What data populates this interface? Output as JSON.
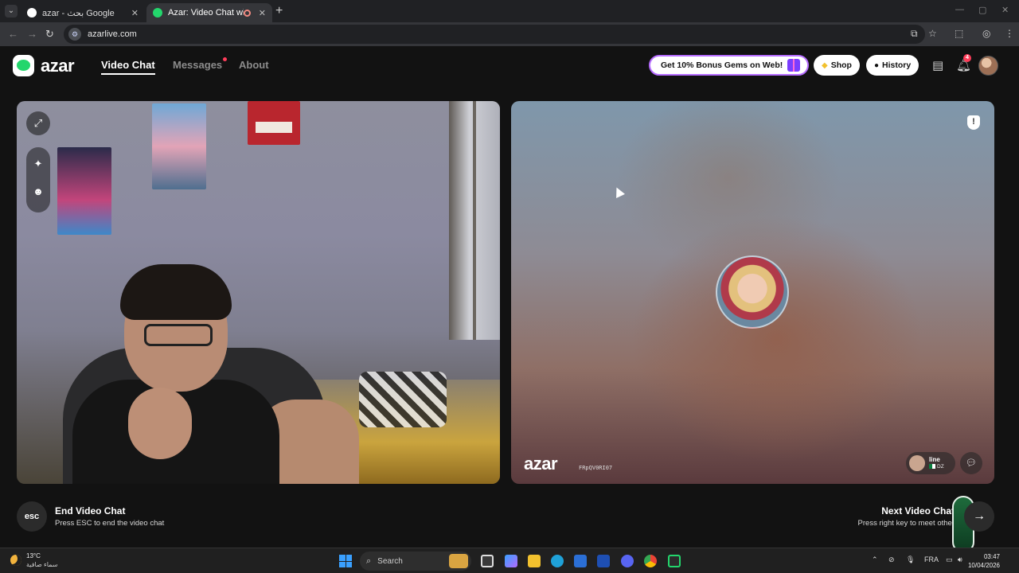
{
  "browser": {
    "tabs": [
      {
        "title": "azar - بحث Google",
        "favicon": "google-icon",
        "active": false
      },
      {
        "title": "Azar: Video Chat with New",
        "favicon": "azar-icon",
        "active": true
      }
    ],
    "url": "azarlive.com"
  },
  "app": {
    "logo_text": "azar",
    "nav": [
      {
        "label": "Video Chat",
        "active": true
      },
      {
        "label": "Messages",
        "active": false,
        "has_dot": true
      },
      {
        "label": "About",
        "active": false
      }
    ],
    "promo_label": "Get 10% Bonus Gems on Web!",
    "shop_label": "Shop",
    "history_label": "History",
    "notification_count": "4",
    "accent_color": "#23d66c",
    "promo_border_color": "#b66cff"
  },
  "peer": {
    "watermark": "azar",
    "watermark_id": "FRpQV0RI07",
    "name": "line",
    "country": "DZ"
  },
  "controls": {
    "end_key": "esc",
    "end_title": "End Video Chat",
    "end_hint": "Press ESC to end the video chat",
    "next_title": "Next Video Chat",
    "next_hint": "Press right key to meet other"
  },
  "taskbar": {
    "weather_temp": "13°C",
    "weather_desc": "سماء صافية",
    "search_placeholder": "Search",
    "language": "FRA",
    "time": "03:47",
    "date": "10/04/2026"
  }
}
